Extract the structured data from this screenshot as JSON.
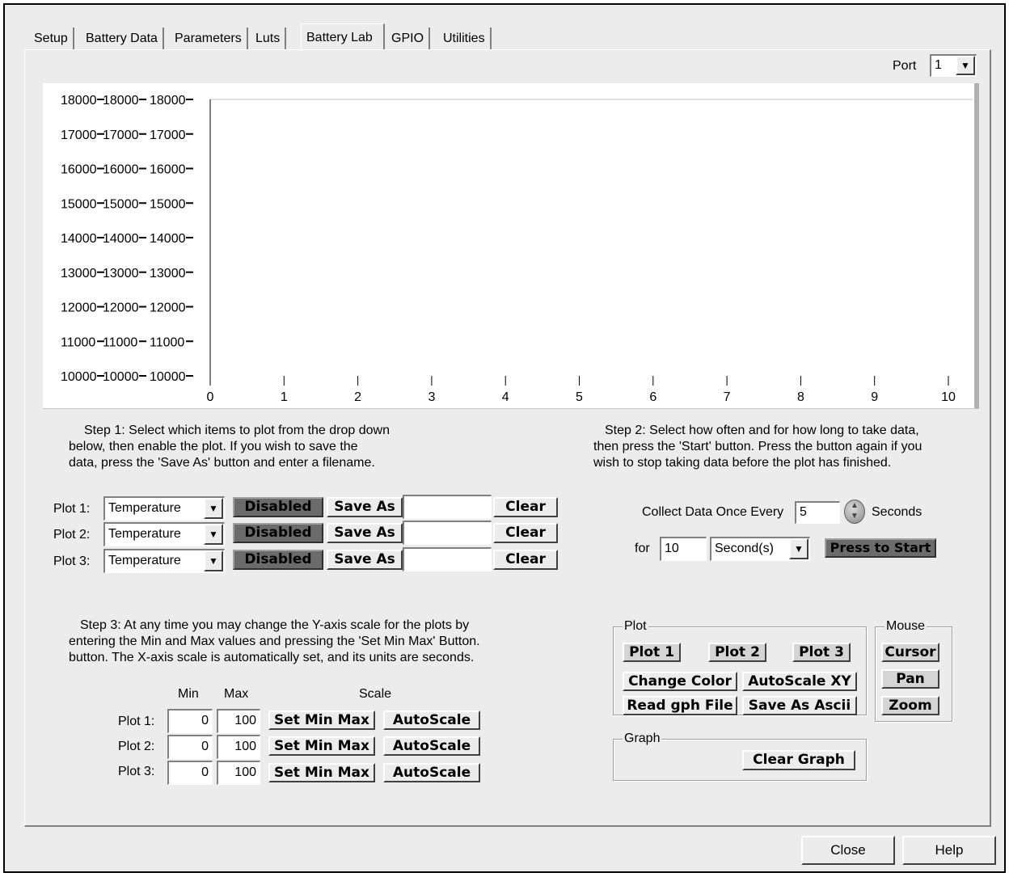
{
  "tabs": [
    "Setup",
    "Battery Data",
    "Parameters",
    "Luts",
    "Battery Lab",
    "GPIO",
    "Utilities"
  ],
  "active_tab": "Battery Lab",
  "port": {
    "label": "Port",
    "value": "1"
  },
  "chart_data": {
    "type": "line",
    "title": "",
    "xlabel": "",
    "ylabel": "",
    "xlim": [
      0,
      10
    ],
    "ylim": [
      10000,
      18000
    ],
    "x_ticks": [
      0,
      1,
      2,
      3,
      4,
      5,
      6,
      7,
      8,
      9,
      10
    ],
    "y_ticks": [
      10000,
      11000,
      12000,
      13000,
      14000,
      15000,
      16000,
      17000,
      18000
    ],
    "y_axes_count": 3,
    "series": [],
    "grid": false
  },
  "step1": {
    "line1": "Step 1: Select which items to plot from the drop down",
    "line2": "below, then enable the plot.  If you wish to save the",
    "line3": "data, press the 'Save As' button and enter a filename."
  },
  "step2": {
    "line1": "Step 2: Select how often and for how long to take data,",
    "line2": "then press the 'Start' button.  Press the button again if you",
    "line3": "wish to stop taking data before the plot has finished."
  },
  "plots": [
    {
      "label": "Plot 1:",
      "item": "Temperature",
      "enable": "Disabled",
      "save": "Save As",
      "filename": "",
      "clear": "Clear"
    },
    {
      "label": "Plot 2:",
      "item": "Temperature",
      "enable": "Disabled",
      "save": "Save As",
      "filename": "",
      "clear": "Clear"
    },
    {
      "label": "Plot 3:",
      "item": "Temperature",
      "enable": "Disabled",
      "save": "Save As",
      "filename": "",
      "clear": "Clear"
    }
  ],
  "collect": {
    "label": "Collect Data Once Every",
    "interval": "5",
    "interval_unit": "Seconds",
    "for_label": "for",
    "duration": "10",
    "duration_unit": "Second(s)",
    "start_button": "Press to Start"
  },
  "step3": {
    "line1": "Step 3: At any time you may change the Y-axis scale for the plots by",
    "line2": "entering the Min and Max values and pressing the 'Set Min Max' Button.",
    "line3": "button.  The X-axis scale is automatically set, and its units are seconds."
  },
  "scale_headers": {
    "min": "Min",
    "max": "Max",
    "scale": "Scale"
  },
  "scales": [
    {
      "label": "Plot 1:",
      "min": "0",
      "max": "100",
      "set": "Set Min Max",
      "auto": "AutoScale"
    },
    {
      "label": "Plot 2:",
      "min": "0",
      "max": "100",
      "set": "Set Min Max",
      "auto": "AutoScale"
    },
    {
      "label": "Plot 3:",
      "min": "0",
      "max": "100",
      "set": "Set Min Max",
      "auto": "AutoScale"
    }
  ],
  "plot_group": {
    "label": "Plot",
    "plot1": "Plot 1",
    "plot2": "Plot 2",
    "plot3": "Plot 3",
    "change_color": "Change Color",
    "autoscale_xy": "AutoScale XY",
    "read_gph": "Read gph File",
    "save_ascii": "Save As Ascii"
  },
  "mouse_group": {
    "label": "Mouse",
    "cursor": "Cursor",
    "pan": "Pan",
    "zoom": "Zoom"
  },
  "graph_group": {
    "label": "Graph",
    "clear_graph": "Clear Graph"
  },
  "footer": {
    "close": "Close",
    "help": "Help"
  }
}
